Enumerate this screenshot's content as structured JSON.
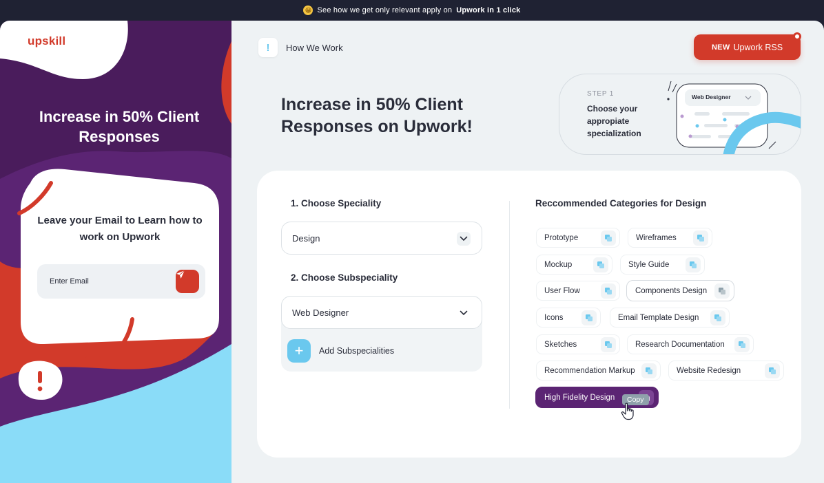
{
  "banner": {
    "emoji": "😁",
    "text": "See how we get only relevant apply on",
    "highlight": "Upwork in 1 click"
  },
  "sidebar": {
    "logo": "upskill",
    "title": "Increase in 50% Client Responses",
    "email_prompt": "Leave your Email to Learn how to work on Upwork",
    "email_placeholder": "Enter Email"
  },
  "header": {
    "how_icon_glyph": "!",
    "how_label": "How We Work",
    "rss_badge": "NEW",
    "rss_label": "Upwork RSS"
  },
  "hero": {
    "title": "Increase in 50% Client Responses on Upwork!"
  },
  "step": {
    "number": "STEP 1",
    "description": "Choose your appropiate specialization",
    "preview_dropdown": "Web Designer"
  },
  "form": {
    "speciality_label": "1. Choose Speciality",
    "speciality_value": "Design",
    "subspeciality_label": "2. Choose Subspeciality",
    "subspeciality_value": "Web Designer",
    "add_label": "Add Subspecialities",
    "add_glyph": "+"
  },
  "recommended": {
    "title": "Reccommended Categories for Design",
    "chips": [
      {
        "label": "Prototype"
      },
      {
        "label": "Wireframes"
      },
      {
        "label": "Mockup"
      },
      {
        "label": "Style Guide"
      },
      {
        "label": "User Flow"
      },
      {
        "label": "Components Design"
      },
      {
        "label": "Icons"
      },
      {
        "label": "Email Template Design"
      },
      {
        "label": "Sketches"
      },
      {
        "label": "Research Documentation"
      },
      {
        "label": "Recommendation Markup"
      },
      {
        "label": "Website Redesign"
      },
      {
        "label": "High Fidelity Design"
      }
    ],
    "tooltip": "Copy"
  },
  "colors": {
    "brand_red": "#d23a2a",
    "brand_purple": "#5b2473",
    "accent_blue": "#6ac8ee"
  }
}
